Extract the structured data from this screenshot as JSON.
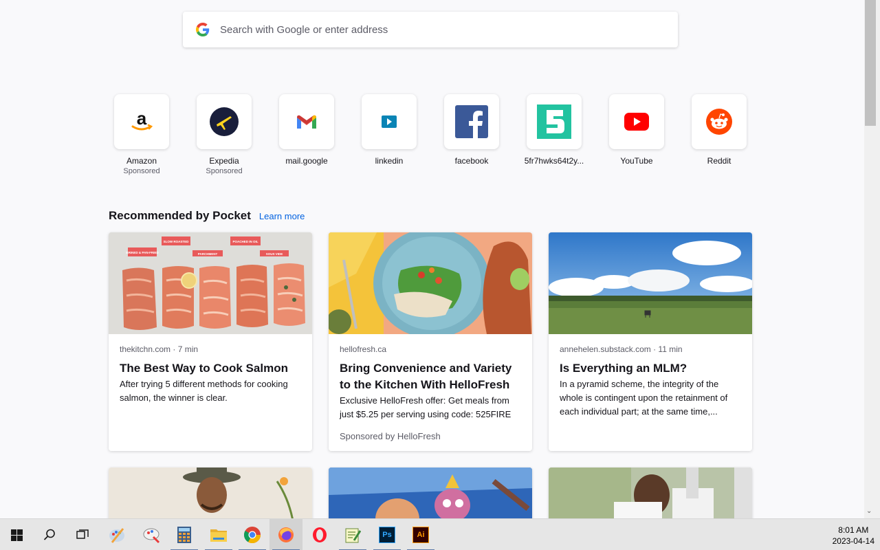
{
  "search": {
    "placeholder": "Search with Google or enter address"
  },
  "top_sites": [
    {
      "title": "Amazon",
      "sponsored": "Sponsored",
      "icon": "amazon-icon"
    },
    {
      "title": "Expedia",
      "sponsored": "Sponsored",
      "icon": "expedia-icon"
    },
    {
      "title": "mail.google",
      "sponsored": "",
      "icon": "gmail-icon"
    },
    {
      "title": "linkedin",
      "sponsored": "",
      "icon": "linkedin-icon"
    },
    {
      "title": "facebook",
      "sponsored": "",
      "icon": "facebook-icon"
    },
    {
      "title": "5fr7hwks64t2y...",
      "sponsored": "",
      "icon": "five-logo-icon"
    },
    {
      "title": "YouTube",
      "sponsored": "",
      "icon": "youtube-icon"
    },
    {
      "title": "Reddit",
      "sponsored": "",
      "icon": "reddit-icon"
    }
  ],
  "pocket": {
    "heading": "Recommended by Pocket",
    "learn_more": "Learn more",
    "cards": [
      {
        "source": "thekitchn.com · 7 min",
        "title": "The Best Way to Cook Salmon",
        "excerpt": "After trying 5 different methods for cooking salmon, the winner is clear.",
        "sponsored": "",
        "image_labels": [
          "BRINED & PAN-FRIED",
          "SLOW ROASTED",
          "PARCHMENT",
          "POACHED IN OIL",
          "SOUS VIDE"
        ]
      },
      {
        "source": "hellofresh.ca",
        "title": "Bring Convenience and Variety to the Kitchen With HelloFresh",
        "excerpt": "Exclusive HelloFresh offer: Get meals from just $5.25 per serving using code: 525FIRE",
        "sponsored": "Sponsored by HelloFresh"
      },
      {
        "source": "annehelen.substack.com · 11 min",
        "title": "Is Everything an MLM?",
        "excerpt": "In a pyramid scheme, the integrity of the whole is contingent upon the retainment of each individual part; at the same time,...",
        "sponsored": ""
      }
    ]
  },
  "taskbar": {
    "items": [
      "start-icon",
      "search-icon",
      "task-view-icon",
      "paint-icon",
      "paint-3d-icon",
      "calculator-icon",
      "file-explorer-icon",
      "chrome-icon",
      "firefox-icon",
      "opera-icon",
      "notepad-plus-icon",
      "photoshop-icon",
      "illustrator-icon"
    ],
    "ps_label": "Ps",
    "ai_label": "Ai",
    "time": "8:01 AM",
    "date": "2023-04-14"
  },
  "colors": {
    "accent": "#0061e0",
    "taskbar": "#e6e6e6"
  }
}
